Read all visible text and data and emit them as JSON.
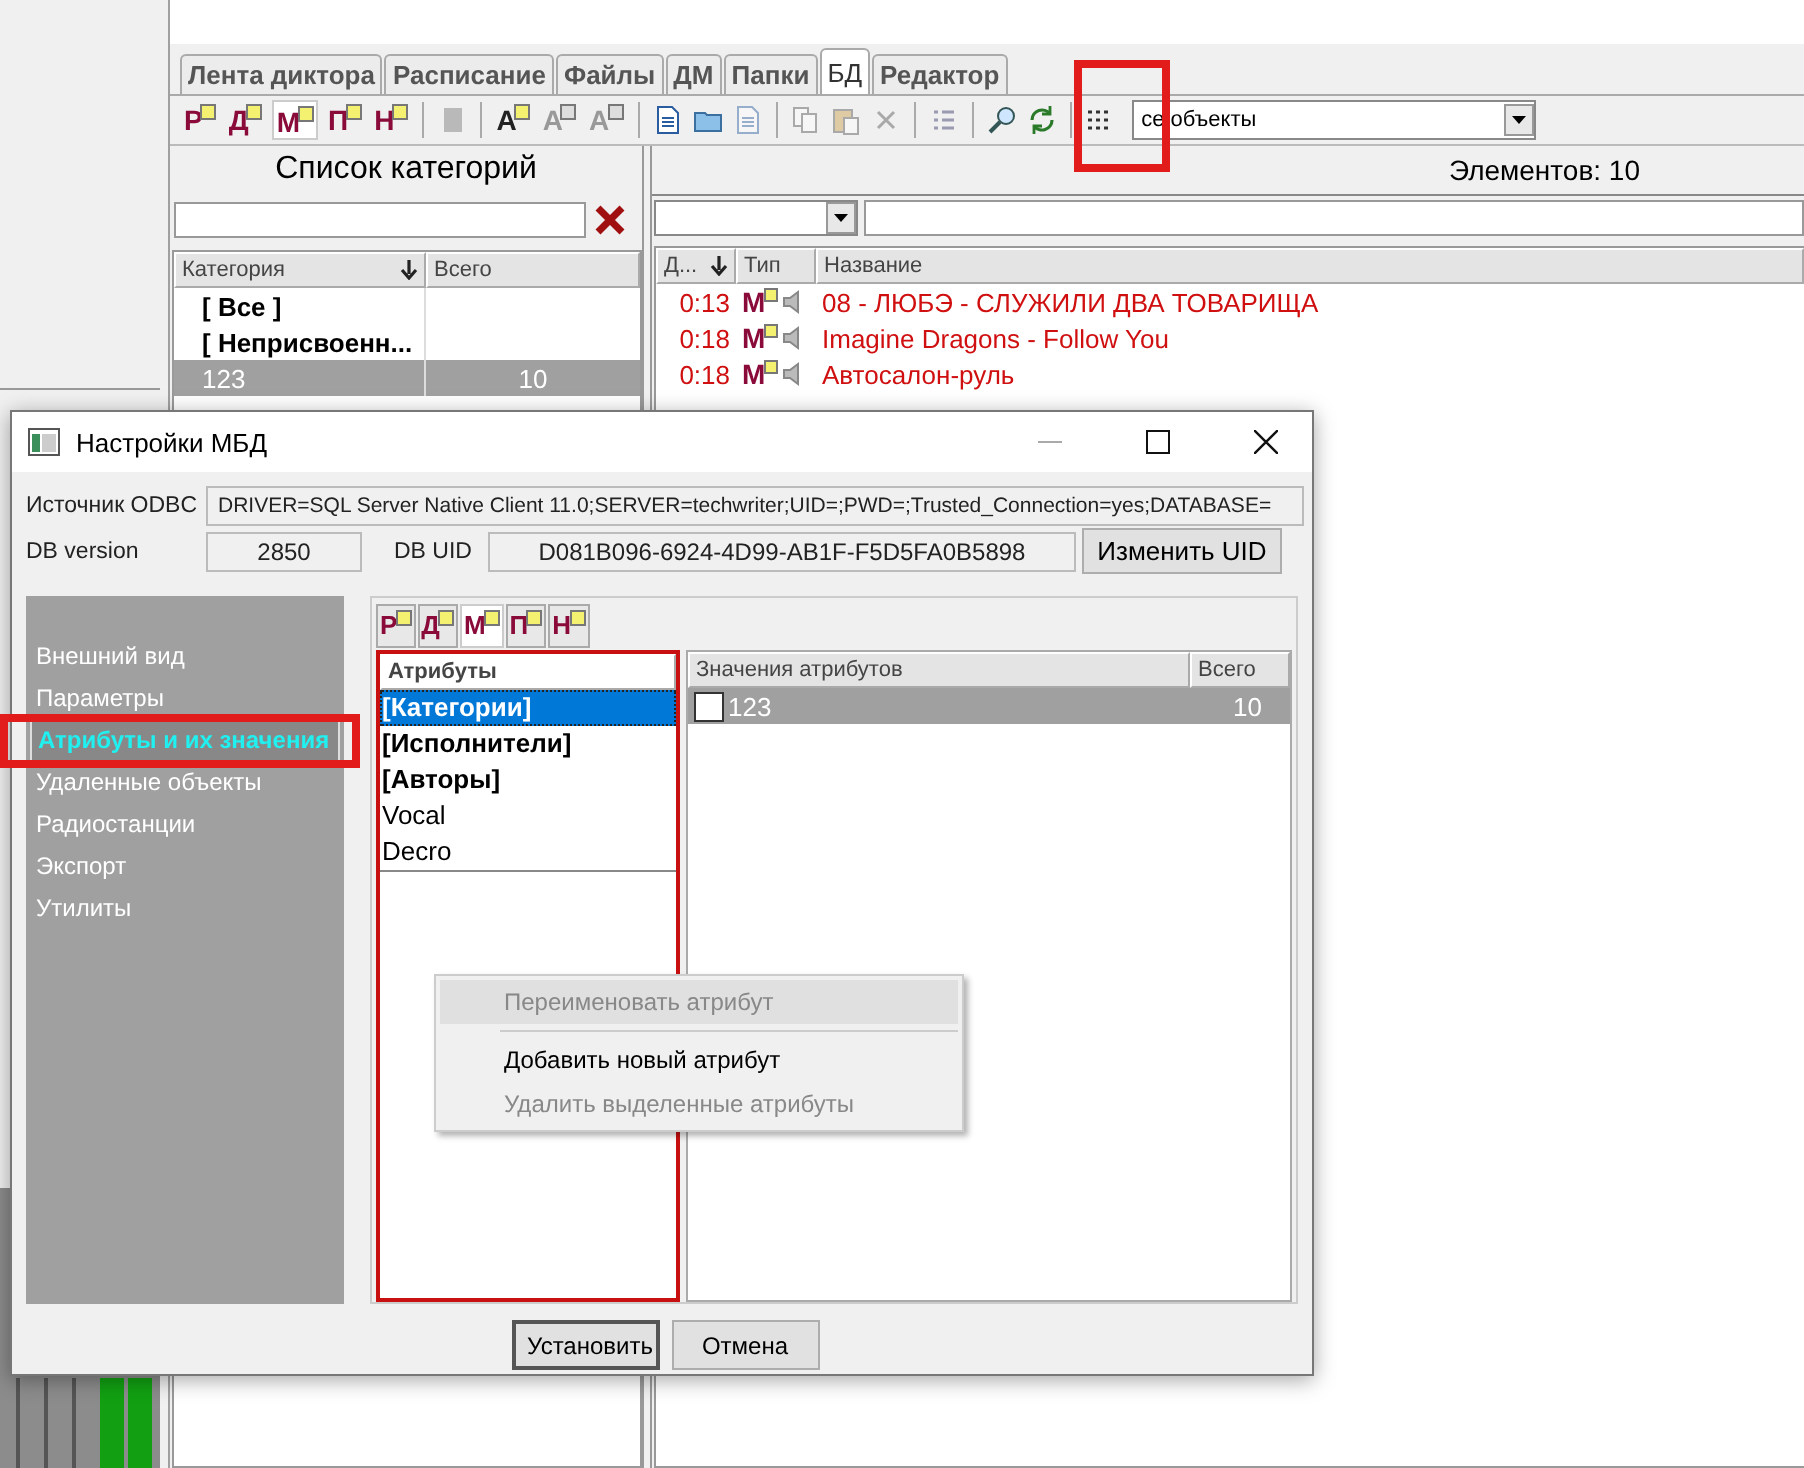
{
  "tabs": [
    {
      "label": "Лента диктора",
      "selected": false
    },
    {
      "label": "Расписание",
      "selected": false
    },
    {
      "label": "Файлы",
      "selected": false
    },
    {
      "label": "ДМ",
      "selected": false
    },
    {
      "label": "Папки",
      "selected": false
    },
    {
      "label": "БД",
      "selected": true
    },
    {
      "label": "Редактор",
      "selected": false
    }
  ],
  "toolbar": [
    {
      "kind": "letter",
      "label": "Р",
      "selected": false
    },
    {
      "kind": "letter",
      "label": "Д",
      "selected": false
    },
    {
      "kind": "letter",
      "label": "М",
      "selected": true
    },
    {
      "kind": "letter",
      "label": "П",
      "selected": false
    },
    {
      "kind": "letter",
      "label": "Н",
      "selected": false
    },
    {
      "kind": "separator"
    },
    {
      "kind": "block",
      "disabled": true
    },
    {
      "kind": "separator"
    },
    {
      "kind": "font",
      "label": "A",
      "disabled": false
    },
    {
      "kind": "font",
      "label": "A",
      "disabled": true
    },
    {
      "kind": "font",
      "label": "A",
      "disabled": true
    },
    {
      "kind": "separator"
    },
    {
      "kind": "document",
      "disabled": false
    },
    {
      "kind": "folder",
      "disabled": false
    },
    {
      "kind": "document",
      "disabled": true
    },
    {
      "kind": "separator"
    },
    {
      "kind": "copy",
      "disabled": true
    },
    {
      "kind": "paste",
      "disabled": true
    },
    {
      "kind": "delete",
      "disabled": true
    },
    {
      "kind": "separator"
    },
    {
      "kind": "list",
      "disabled": true
    },
    {
      "kind": "separator"
    },
    {
      "kind": "search",
      "disabled": false
    },
    {
      "kind": "refresh",
      "disabled": false
    },
    {
      "kind": "separator"
    },
    {
      "kind": "grid",
      "disabled": false
    },
    {
      "kind": "dropdown",
      "value": "се объекты"
    }
  ],
  "categories": {
    "title": "Список категорий",
    "columns": [
      "Категория",
      "Всего"
    ],
    "rows": [
      {
        "name": "[ Все ]",
        "bold": true,
        "selected": false
      },
      {
        "name": "[ Неприсвоенн...",
        "bold": true,
        "selected": false
      },
      {
        "name": "123",
        "total": "10",
        "bold": false,
        "selected": true
      }
    ]
  },
  "elements": {
    "count": "Элементов: 10",
    "columns": [
      "Д...",
      "Тип",
      "Название"
    ],
    "rows": [
      {
        "duration": "0:13",
        "type": "М",
        "title": "08 - ЛЮБЭ - СЛУЖИЛИ ДВА ТОВАРИЩА"
      },
      {
        "duration": "0:18",
        "type": "М",
        "title": "Imagine Dragons - Follow You"
      },
      {
        "duration": "0:18",
        "type": "М",
        "title": "Автосалон-руль"
      }
    ]
  },
  "dialog": {
    "title": "Настройки МБД",
    "odbc_label": "Источник ODBC",
    "odbc_value": "DRIVER=SQL Server Native Client 11.0;SERVER=techwriter;UID=;PWD=;Trusted_Connection=yes;DATABASE=",
    "version_label": "DB version",
    "version_value": "2850",
    "uid_label": "DB UID",
    "uid_value": "D081B096-6924-4D99-AB1F-F5D5FA0B5898",
    "change_uid_button": "Изменить UID",
    "nav": [
      {
        "label": "Внешний вид",
        "selected": false
      },
      {
        "label": "Параметры",
        "selected": false
      },
      {
        "label": "Атрибуты и их значения",
        "selected": true
      },
      {
        "label": "Удаленные объекты",
        "selected": false
      },
      {
        "label": "Радиостанции",
        "selected": false
      },
      {
        "label": "Экспорт",
        "selected": false
      },
      {
        "label": "Утилиты",
        "selected": false
      }
    ],
    "type_tabs": [
      {
        "label": "Р",
        "selected": false
      },
      {
        "label": "Д",
        "selected": false
      },
      {
        "label": "М",
        "selected": true
      },
      {
        "label": "П",
        "selected": false
      },
      {
        "label": "Н",
        "selected": false
      }
    ],
    "attributes": {
      "header": "Атрибуты",
      "items": [
        {
          "label": "[Категории]",
          "bold": true,
          "selected": true
        },
        {
          "label": "[Исполнители]",
          "bold": true,
          "selected": false
        },
        {
          "label": "[Авторы]",
          "bold": true,
          "selected": false
        },
        {
          "label": "Vocal",
          "bold": false,
          "selected": false
        },
        {
          "label": "Decro",
          "bold": false,
          "selected": false
        }
      ]
    },
    "values": {
      "columns": [
        "Значения атрибутов",
        "Всего"
      ],
      "rows": [
        {
          "checked": false,
          "value": "123",
          "total": "10",
          "selected": true
        }
      ]
    },
    "context_menu": [
      {
        "kind": "item",
        "label": "Переименовать атрибут",
        "disabled": true,
        "selected": true
      },
      {
        "kind": "separator"
      },
      {
        "kind": "item",
        "label": "Добавить новый атрибут",
        "disabled": false,
        "selected": false
      },
      {
        "kind": "item",
        "label": "Удалить выделенные атрибуты",
        "disabled": true,
        "selected": false
      }
    ],
    "buttons": [
      {
        "label": "Установить",
        "default": true
      },
      {
        "label": "Отмена",
        "default": false
      }
    ]
  }
}
